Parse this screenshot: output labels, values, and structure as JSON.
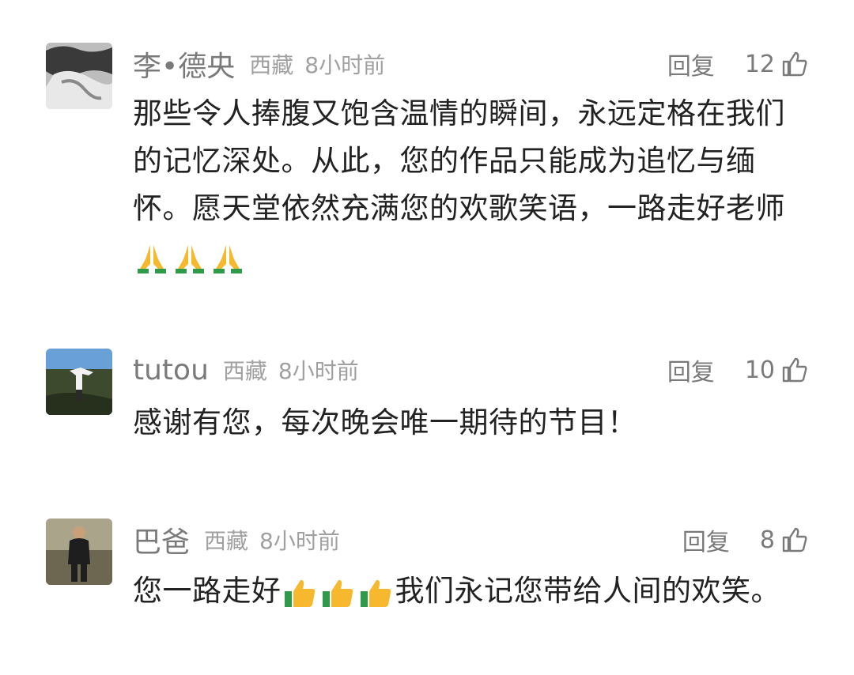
{
  "comments": [
    {
      "user": "李•德央",
      "location": "西藏",
      "time": "8小时前",
      "reply_label": "回复",
      "likes": "12",
      "text_before": "那些令人捧腹又饱含温情的瞬间，永远定格在我们的记忆深处。从此，您的作品只能成为追忆与缅怀。愿天堂依然充满您的欢歌笑语，一路走好老师",
      "text_after": "",
      "emoji": "folded-hands-icon",
      "emoji_count": 3
    },
    {
      "user": "tutou",
      "location": "西藏",
      "time": "8小时前",
      "reply_label": "回复",
      "likes": "10",
      "text_before": "感谢有您，每次晚会唯一期待的节目！",
      "text_after": "",
      "emoji": "",
      "emoji_count": 0
    },
    {
      "user": "巴爸",
      "location": "西藏",
      "time": "8小时前",
      "reply_label": "回复",
      "likes": "8",
      "text_before": "您一路走好",
      "text_after": "我们永记您带给人间的欢笑。",
      "emoji": "thumbs-up-icon",
      "emoji_count": 3
    }
  ],
  "colors": {
    "meta_text": "#7a7a7a",
    "meta_light": "#a0a0a0",
    "body_text": "#222222",
    "emoji_yellow": "#f5b82e",
    "emoji_green": "#2e9a4a"
  }
}
